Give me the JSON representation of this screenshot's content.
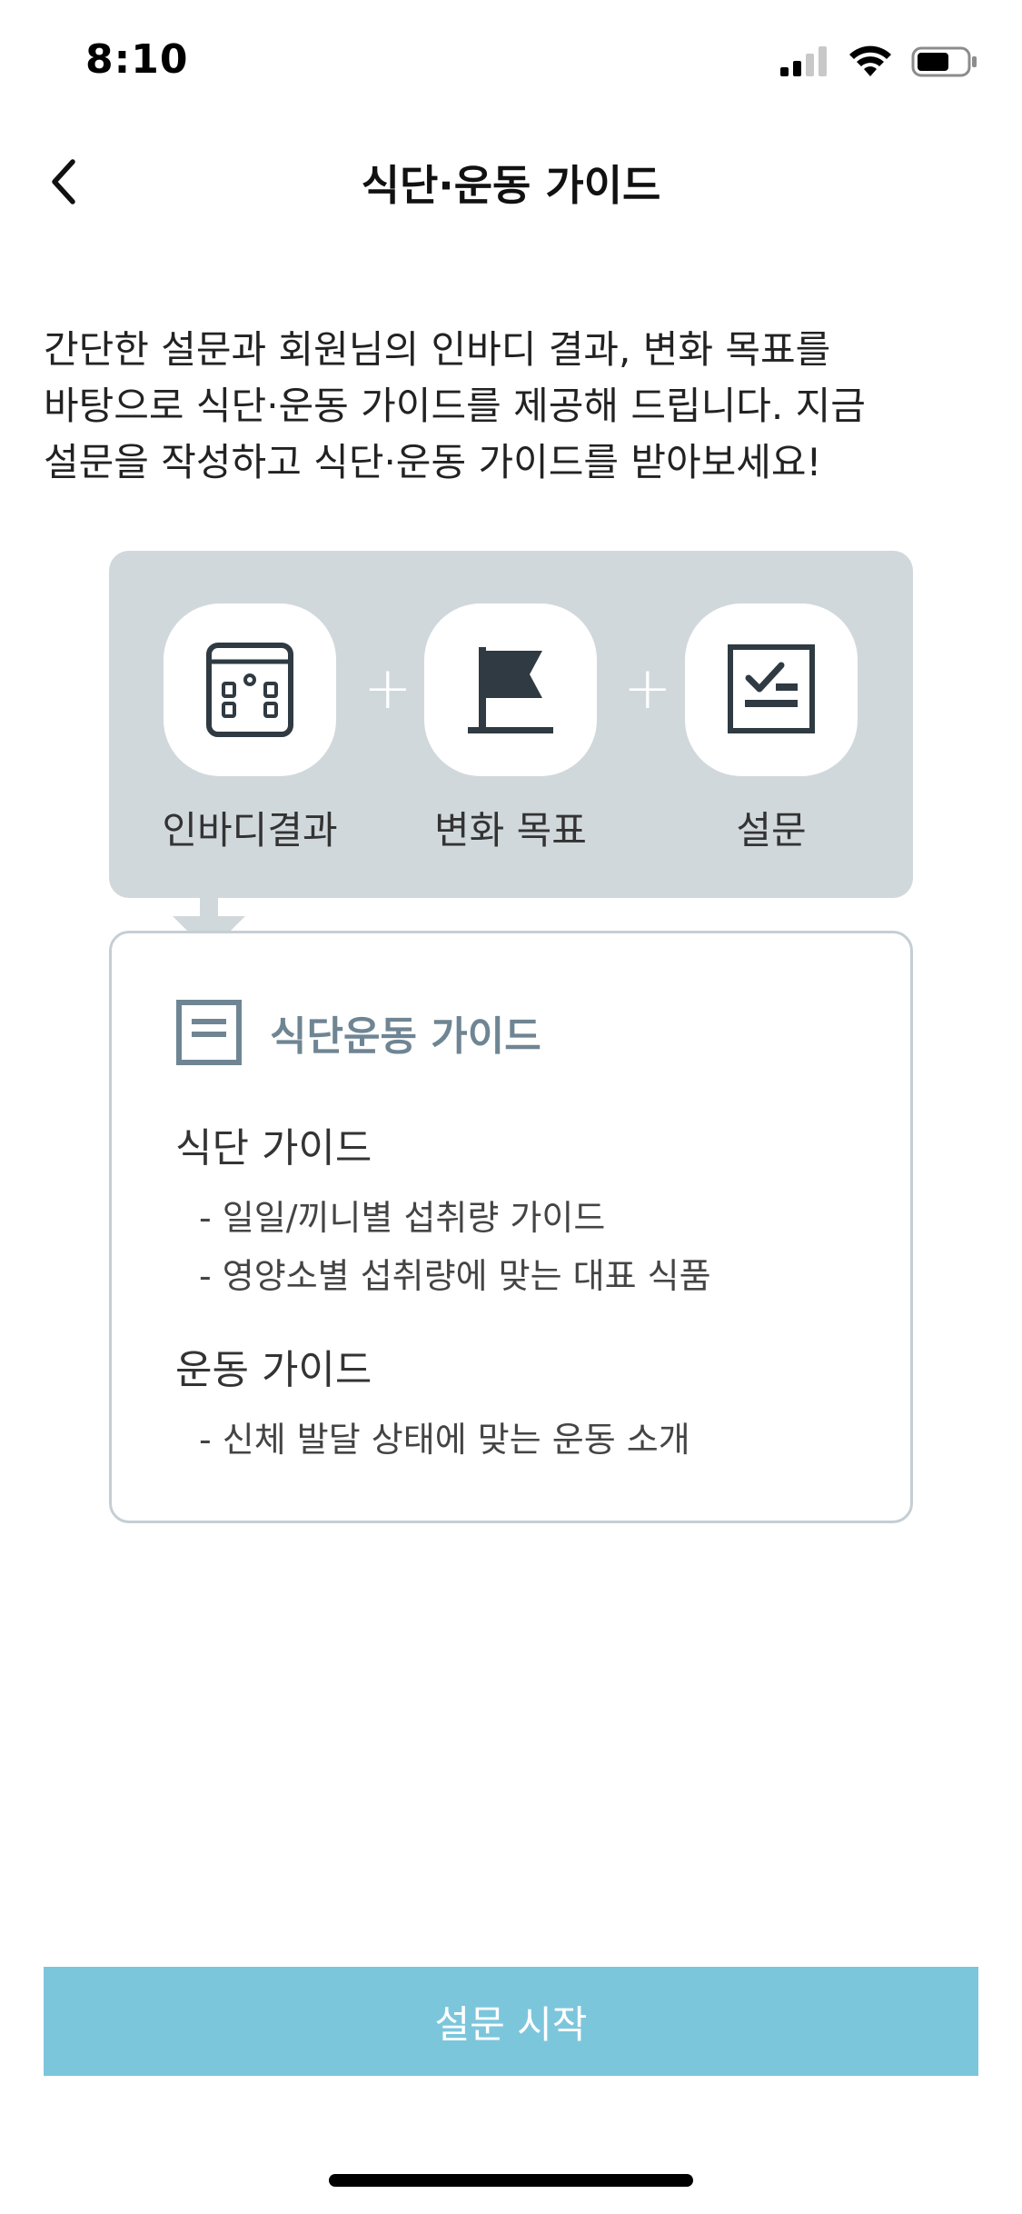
{
  "status_bar": {
    "time": "8:10"
  },
  "header": {
    "title": "식단·운동 가이드",
    "back_icon": "chevron-left-icon"
  },
  "intro": {
    "text": "간단한 설문과 회원님의 인바디 결과, 변화 목표를 바탕으로 식단·운동 가이드를 제공해 드립니다. 지금 설문을 작성하고 식단·운동 가이드를 받아보세요!"
  },
  "sources": {
    "items": [
      {
        "label": "인바디결과",
        "icon": "inbody-device-icon"
      },
      {
        "label": "변화 목표",
        "icon": "flag-icon"
      },
      {
        "label": "설문",
        "icon": "checklist-icon"
      }
    ],
    "plus_symbol": "+"
  },
  "guide": {
    "title": "식단운동 가이드",
    "icon": "document-icon",
    "diet": {
      "title": "식단 가이드",
      "bullets": [
        "- 일일/끼니별 섭취량 가이드",
        "- 영양소별 섭취량에 맞는 대표 식품"
      ]
    },
    "exercise": {
      "title": "운동 가이드",
      "bullets": [
        "- 신체 발달 상태에 맞는 운동 소개"
      ]
    }
  },
  "cta": {
    "label": "설문 시작"
  },
  "colors": {
    "panel_bg": "#d1d8dc",
    "card_border": "#c5ced4",
    "card_title": "#6f8593",
    "cta_bg": "#7cc6dc",
    "icon_dark": "#2f3a42"
  }
}
